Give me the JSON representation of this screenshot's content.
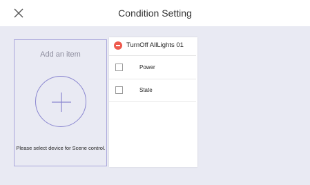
{
  "header": {
    "title": "Condition Setting",
    "close_icon": "close-icon"
  },
  "add_item": {
    "title": "Add an item",
    "icon": "plus-icon",
    "hint": "Please select device for Scene control."
  },
  "device": {
    "name": "TurnOff AllLights 01",
    "remove_icon": "remove-icon",
    "remove_color": "#ee5a4e",
    "conditions": [
      {
        "label": "Power",
        "checked": false
      },
      {
        "label": "State",
        "checked": false
      }
    ]
  },
  "colors": {
    "background": "#e9eaf3",
    "accent": "#8a86d0",
    "card_border": "#a9a6db"
  }
}
